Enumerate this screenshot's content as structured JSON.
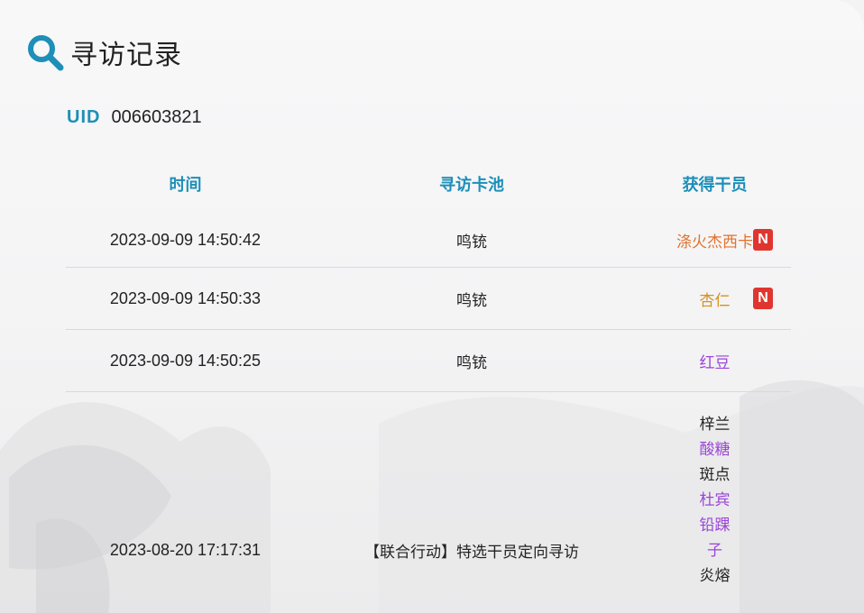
{
  "header": {
    "icon": "search-icon",
    "title": "寻访记录"
  },
  "uid": {
    "label": "UID",
    "value": "006603821"
  },
  "colors": {
    "accent": "#1d8fb8",
    "new_badge": "#e0352f",
    "rarity_6": "#e0732f",
    "rarity_5": "#d7901f",
    "rarity_4": "#9b45d7",
    "rarity_3": "#222222"
  },
  "table": {
    "headers": {
      "time": "时间",
      "pool": "寻访卡池",
      "operator": "获得干员"
    },
    "rows": [
      {
        "time": "2023-09-09 14:50:42",
        "pool": "鸣铳",
        "operator": "涤火杰西卡",
        "rarity": "r6",
        "new": "N"
      },
      {
        "time": "2023-09-09 14:50:33",
        "pool": "鸣铳",
        "operator": "杏仁",
        "rarity": "r5",
        "new": "N"
      },
      {
        "time": "2023-09-09 14:50:25",
        "pool": "鸣铳",
        "operator": "红豆",
        "rarity": "r4"
      }
    ],
    "multi_row": {
      "time": "2023-08-20 17:17:31",
      "pool": "【联合行动】特选干员定向寻访",
      "operators": [
        {
          "name": "梓兰",
          "rarity": "r3"
        },
        {
          "name": "酸糖",
          "rarity": "r4"
        },
        {
          "name": "斑点",
          "rarity": "r3"
        },
        {
          "name": "杜宾",
          "rarity": "r4"
        },
        {
          "name": "铅踝子",
          "rarity": "r4"
        },
        {
          "name": "炎熔",
          "rarity": "r3"
        }
      ]
    }
  }
}
